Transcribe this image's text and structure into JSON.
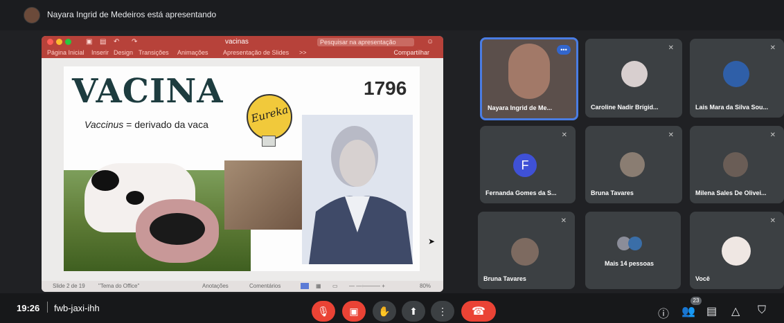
{
  "header": {
    "presenter_text": "Nayara Ingrid de Medeiros está apresentando"
  },
  "ppt": {
    "filename": "vacinas",
    "search_placeholder": "Pesquisar na apresentação",
    "menu": [
      "Página Inicial",
      "Inserir",
      "Design",
      "Transições",
      "Animações",
      "Apresentação de Slides",
      ">>"
    ],
    "share": "Compartilhar",
    "status_slide": "Slide 2 de 19",
    "status_theme": "\"Tema do Office\"",
    "status_notes": "Anotações",
    "status_comments": "Comentários",
    "zoom": "80%"
  },
  "slide": {
    "title": "VACINA",
    "year": "1796",
    "subtitle_italic": "Vaccinus",
    "subtitle_rest": " = derivado da vaca",
    "eureka": "Eureka"
  },
  "participants": [
    {
      "name": "Nayara Ingrid de Me...",
      "more": "•••"
    },
    {
      "name": "Caroline Nadir Brígid..."
    },
    {
      "name": "Lais Mara da Silva Sou..."
    },
    {
      "name": "Fernanda Gomes da S...",
      "initial": "F"
    },
    {
      "name": "Bruna Tavares"
    },
    {
      "name": "Milena Sales De Olivei..."
    },
    {
      "name": "Bruna Tavares"
    },
    {
      "name": "Mais 14 pessoas"
    },
    {
      "name": "Você"
    }
  ],
  "bottom": {
    "time": "19:26",
    "meeting_code": "fwb-jaxi-ihh",
    "people_count": "23"
  },
  "colors": {
    "accent": "#4a7de4",
    "danger": "#ea4335",
    "ppt_red": "#b7423a"
  }
}
